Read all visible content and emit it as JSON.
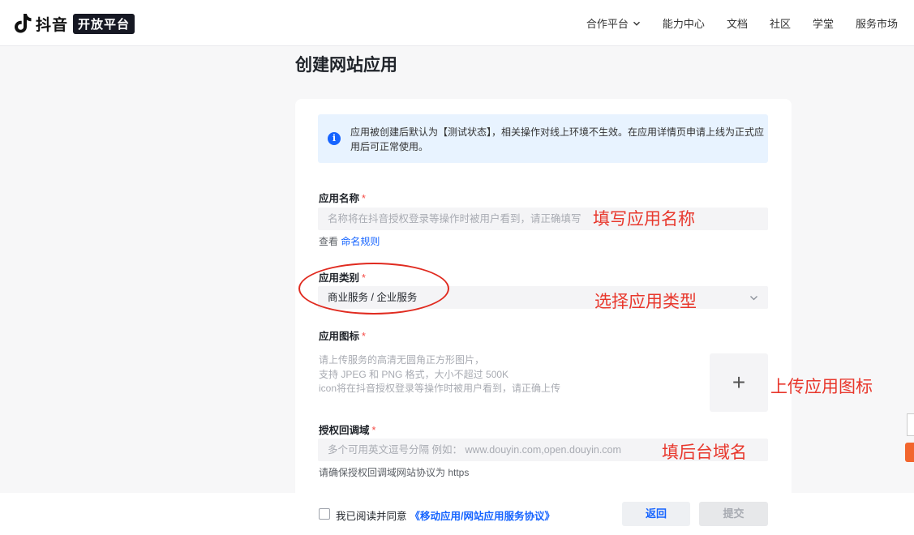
{
  "header": {
    "logo_text": "抖音",
    "logo_badge": "开放平台",
    "nav": [
      {
        "label": "合作平台"
      },
      {
        "label": "能力中心"
      },
      {
        "label": "文档"
      },
      {
        "label": "社区"
      },
      {
        "label": "学堂"
      },
      {
        "label": "服务市场"
      }
    ]
  },
  "page": {
    "title": "创建网站应用"
  },
  "notice": {
    "text": "应用被创建后默认为【测试状态】，相关操作对线上环境不生效。在应用详情页申请上线为正式应用后可正常使用。"
  },
  "form": {
    "app_name": {
      "label": "应用名称",
      "required": "*",
      "placeholder": "名称将在抖音授权登录等操作时被用户看到，请正确填写",
      "hint_prefix": "查看",
      "hint_link": "命名规则"
    },
    "app_category": {
      "label": "应用类别",
      "required": "*",
      "value": "商业服务 / 企业服务"
    },
    "app_icon": {
      "label": "应用图标",
      "required": "*",
      "hint_line1": "请上传服务的高清无圆角正方形图片，",
      "hint_line2": "支持 JPEG 和 PNG 格式，大小不超过 500K",
      "hint_line3": "icon将在抖音授权登录等操作时被用户看到，请正确上传",
      "upload_symbol": "+"
    },
    "callback_domain": {
      "label": "授权回调域",
      "required": "*",
      "placeholder": "多个可用英文逗号分隔 例如： www.douyin.com,open.douyin.com",
      "hint": "请确保授权回调域网站协议为 https"
    }
  },
  "annotations": {
    "fill_name": "填写应用名称",
    "choose_type": "选择应用类型",
    "upload_icon": "上传应用图标",
    "fill_domain": "填后台域名"
  },
  "footer": {
    "agree_text": "我已阅读并同意",
    "agree_link": "《移动应用/网站应用服务协议》",
    "back_label": "返回",
    "submit_label": "提交"
  },
  "colors": {
    "accent": "#1664ff",
    "annotation_red": "#e8372c",
    "notice_bg": "#e8f3ff"
  }
}
